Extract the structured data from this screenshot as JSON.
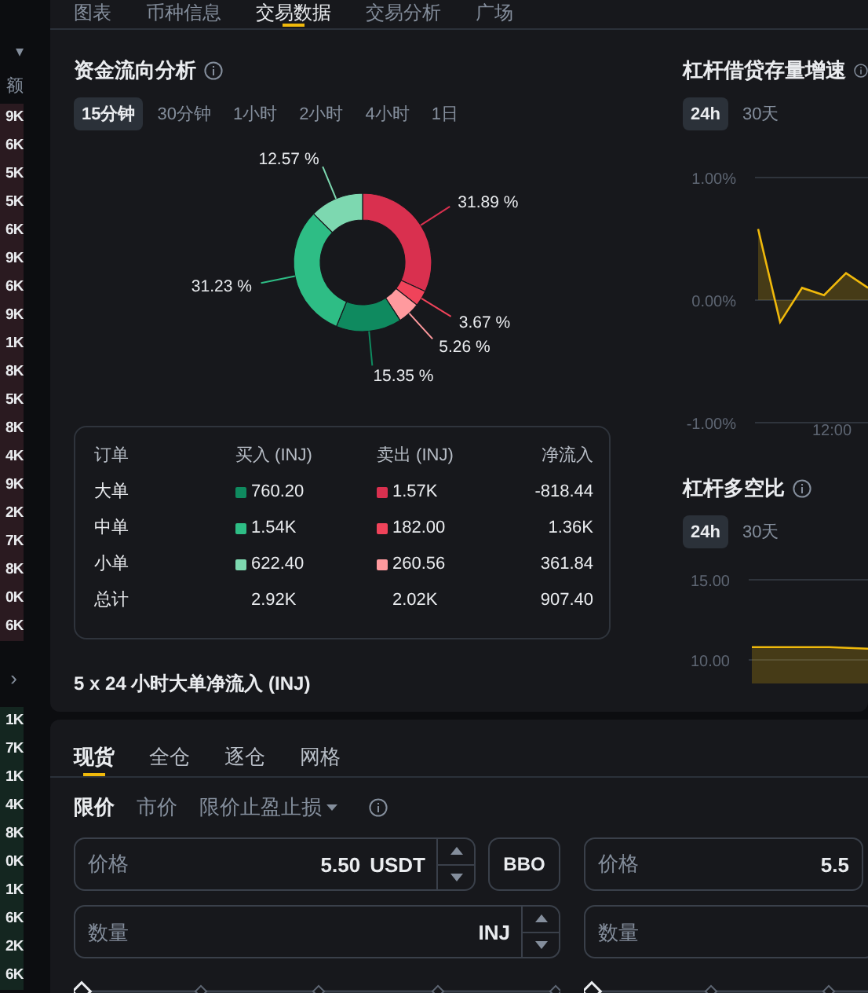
{
  "order_book": {
    "caret": "▾",
    "header": "额",
    "asks": [
      "9K",
      "6K",
      "5K",
      "5K",
      "6K",
      "9K",
      "6K",
      "9K",
      "1K",
      "8K",
      "5K",
      "8K",
      "4K",
      "9K",
      "2K",
      "7K",
      "8K",
      "0K",
      "6K"
    ],
    "expand": "›",
    "bids": [
      "1K",
      "7K",
      "1K",
      "4K",
      "8K",
      "0K",
      "1K",
      "6K",
      "2K",
      "6K"
    ]
  },
  "tabs": [
    {
      "label": "图表",
      "selected": false
    },
    {
      "label": "币种信息",
      "selected": false
    },
    {
      "label": "交易数据",
      "selected": true
    },
    {
      "label": "交易分析",
      "selected": false
    },
    {
      "label": "广场",
      "selected": false
    }
  ],
  "fund_flow": {
    "title": "资金流向分析",
    "periods": [
      {
        "label": "15分钟",
        "selected": true
      },
      {
        "label": "30分钟",
        "selected": false
      },
      {
        "label": "1小时",
        "selected": false
      },
      {
        "label": "2小时",
        "selected": false
      },
      {
        "label": "4小时",
        "selected": false
      },
      {
        "label": "1日",
        "selected": false
      }
    ],
    "chart_data": {
      "type": "donut",
      "values": [
        31.89,
        3.67,
        5.26,
        15.35,
        31.23,
        12.57
      ],
      "value_labels": [
        "31.89 %",
        "3.67 %",
        "5.26 %",
        "15.35 %",
        "31.23 %",
        "12.57 %"
      ],
      "colors": [
        "#d9304f",
        "#f0435a",
        "#ff9a9e",
        "#0f8a5f",
        "#2ebd85",
        "#7dd8b0"
      ]
    },
    "table": {
      "columns": [
        "订单",
        "买入 (INJ)",
        "卖出 (INJ)",
        "净流入"
      ],
      "rows": [
        {
          "label": "大单",
          "buy": {
            "value": "760.20",
            "color": "#0f8a5f"
          },
          "sell": {
            "value": "1.57K",
            "color": "#d9304f"
          },
          "net": "-818.44"
        },
        {
          "label": "中单",
          "buy": {
            "value": "1.54K",
            "color": "#2ebd85"
          },
          "sell": {
            "value": "182.00",
            "color": "#f0435a"
          },
          "net": "1.36K"
        },
        {
          "label": "小单",
          "buy": {
            "value": "622.40",
            "color": "#7dd8b0"
          },
          "sell": {
            "value": "260.56",
            "color": "#ff9a9e"
          },
          "net": "361.84"
        },
        {
          "label": "总计",
          "buy": {
            "value": "2.92K"
          },
          "sell": {
            "value": "2.02K"
          },
          "net": "907.40"
        }
      ]
    },
    "next_heading": "5 x 24 小时大单净流入 (INJ)"
  },
  "margin_growth": {
    "title": "杠杆借贷存量增速",
    "periods": [
      {
        "label": "24h",
        "selected": true
      },
      {
        "label": "30天",
        "selected": false
      }
    ],
    "chart_data": {
      "type": "area",
      "categories": [
        null,
        null,
        null,
        null,
        null,
        null
      ],
      "values": [
        0.58,
        -0.18,
        0.1,
        0.04,
        0.22,
        0.1
      ],
      "ylim": [
        -1,
        1
      ],
      "yticks": [
        {
          "value": 1,
          "label": "1.00%"
        },
        {
          "value": 0,
          "label": "0.00%"
        },
        {
          "value": -1,
          "label": "-1.00%"
        }
      ],
      "annotations": [
        {
          "text": "12:00"
        }
      ]
    }
  },
  "long_short": {
    "title": "杠杆多空比",
    "periods": [
      {
        "label": "24h",
        "selected": true
      },
      {
        "label": "30天",
        "selected": false
      }
    ],
    "chart_data": {
      "type": "area",
      "categories": [
        null,
        null,
        null,
        null
      ],
      "values": [
        10.8,
        10.8,
        10.8,
        10.7
      ],
      "ylim": [
        10,
        15
      ],
      "yticks": [
        {
          "value": 15,
          "label": "15.00"
        },
        {
          "value": 10,
          "label": "10.00"
        }
      ]
    }
  },
  "trade_tabs": [
    {
      "label": "现货",
      "selected": true
    },
    {
      "label": "全仓",
      "selected": false
    },
    {
      "label": "逐仓",
      "selected": false
    },
    {
      "label": "网格",
      "selected": false
    }
  ],
  "order_types": [
    {
      "label": "限价",
      "selected": true,
      "dropdown": false
    },
    {
      "label": "市价",
      "selected": false,
      "dropdown": false
    },
    {
      "label": "限价止盈止损",
      "selected": false,
      "dropdown": true
    }
  ],
  "buy_form": {
    "price": {
      "label": "价格",
      "value": "5.50",
      "unit": "USDT"
    },
    "bbo": "BBO",
    "quantity": {
      "placeholder": "数量",
      "unit": "INJ"
    },
    "slider": {
      "level": 0
    }
  },
  "sell_form": {
    "price": {
      "label": "价格",
      "value": "5.5"
    },
    "quantity": {
      "placeholder": "数量"
    },
    "slider": {
      "level": 0
    }
  }
}
